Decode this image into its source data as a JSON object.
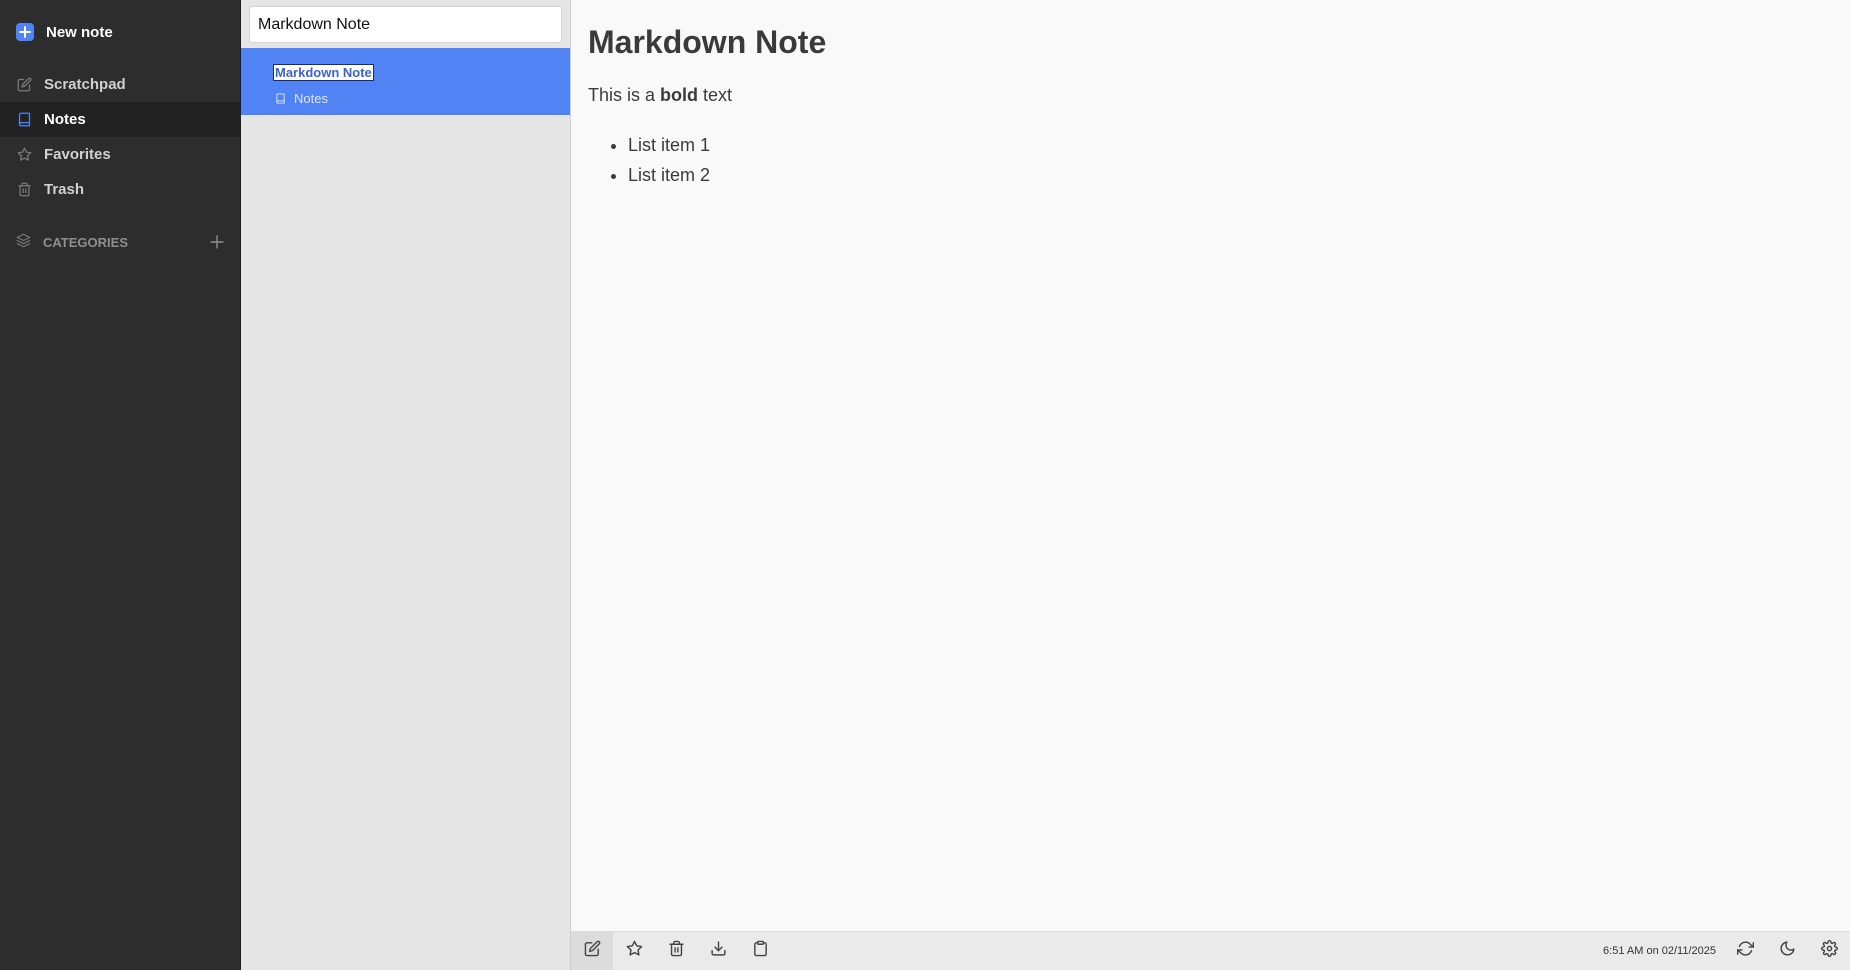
{
  "sidebar": {
    "new_note_label": "New note",
    "items": [
      {
        "label": "Scratchpad",
        "icon": "edit-icon",
        "active": false
      },
      {
        "label": "Notes",
        "icon": "book-icon",
        "active": true
      },
      {
        "label": "Favorites",
        "icon": "star-icon",
        "active": false
      },
      {
        "label": "Trash",
        "icon": "trash-icon",
        "active": false
      }
    ],
    "categories_label": "CATEGORIES"
  },
  "note_list": {
    "search_value": "Markdown Note",
    "notes": [
      {
        "title": "Markdown Note",
        "category": "Notes",
        "selected": true
      }
    ]
  },
  "editor": {
    "heading": "Markdown Note",
    "paragraph_before": "This is a ",
    "paragraph_bold": "bold",
    "paragraph_after": " text",
    "list_items": [
      "List item 1",
      "List item 2"
    ]
  },
  "footer": {
    "status": "6:51 AM on 02/11/2025",
    "left_buttons": [
      "edit-icon",
      "star-icon",
      "trash-icon",
      "download-icon",
      "clipboard-icon"
    ],
    "right_buttons": [
      "sync-icon",
      "moon-icon",
      "gear-icon"
    ]
  },
  "colors": {
    "accent": "#5183f5",
    "sidebar_bg": "#2d2d2d",
    "list_bg": "#e5e5e5",
    "editor_bg": "#f9f9f9"
  }
}
